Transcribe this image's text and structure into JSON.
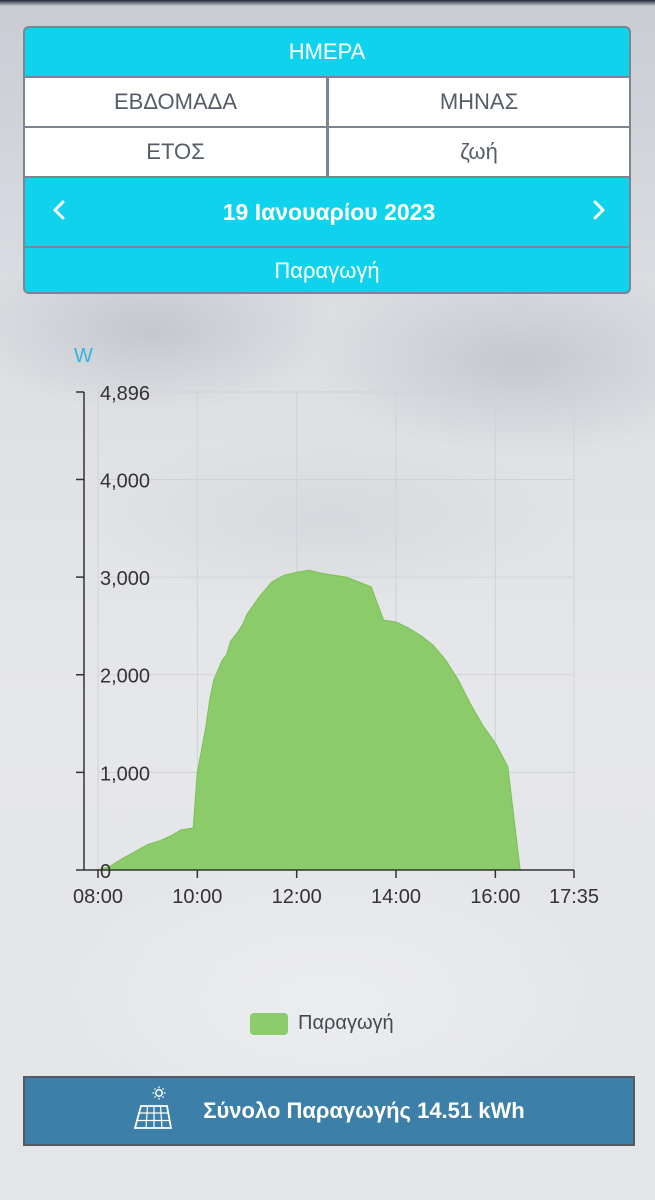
{
  "nav": {
    "day": "ΗΜΕΡΑ",
    "week": "ΕΒΔΟΜΑΔΑ",
    "month": "ΜΗΝΑΣ",
    "year": "ΕΤΟΣ",
    "life": "ζωή",
    "date": "19 Ιανουαρίου 2023",
    "prev_icon": "chevron-left-icon",
    "next_icon": "chevron-right-icon",
    "metric": "Παραγωγή"
  },
  "colors": {
    "accent": "#0fd3ec",
    "area_fill": "#8ccb6a",
    "total_bar": "#3c7fa8"
  },
  "chart_data": {
    "type": "area",
    "unit": "W",
    "y_ticks": [
      "4,896",
      "4,000",
      "3,000",
      "2,000",
      "1,000",
      "0"
    ],
    "y_tick_values": [
      4896,
      4000,
      3000,
      2000,
      1000,
      0
    ],
    "x_ticks": [
      "08:00",
      "10:00",
      "12:00",
      "14:00",
      "16:00",
      "17:35"
    ],
    "x_tick_values": [
      "08:00",
      "10:00",
      "12:00",
      "14:00",
      "16:00",
      "17:35"
    ],
    "ylim": [
      0,
      4896
    ],
    "xlim": [
      "08:00",
      "17:35"
    ],
    "grid": true,
    "legend_position": "bottom",
    "series": [
      {
        "name": "Παραγωγή",
        "x": [
          "08:00",
          "08:15",
          "08:30",
          "08:45",
          "09:00",
          "09:15",
          "09:30",
          "09:40",
          "09:55",
          "10:00",
          "10:10",
          "10:15",
          "10:20",
          "10:30",
          "10:35",
          "10:40",
          "10:50",
          "10:55",
          "11:00",
          "11:15",
          "11:30",
          "11:45",
          "12:00",
          "12:15",
          "12:30",
          "12:45",
          "13:00",
          "13:15",
          "13:30",
          "13:45",
          "14:00",
          "14:15",
          "14:30",
          "14:45",
          "15:00",
          "15:15",
          "15:30",
          "15:45",
          "16:00",
          "16:15",
          "16:30",
          "16:45",
          "17:00",
          "17:15",
          "17:35"
        ],
        "y": [
          0,
          40,
          120,
          190,
          260,
          300,
          360,
          410,
          430,
          1000,
          1450,
          1750,
          1950,
          2150,
          2200,
          2340,
          2450,
          2520,
          2620,
          2800,
          2950,
          3020,
          3050,
          3070,
          3040,
          3020,
          3000,
          2950,
          2900,
          2560,
          2540,
          2480,
          2400,
          2300,
          2150,
          1950,
          1700,
          1480,
          1300,
          1060,
          0,
          0,
          0,
          0,
          0
        ]
      }
    ]
  },
  "legend": {
    "label": "Παραγωγή"
  },
  "total": {
    "label": "Σύνολο Παραγωγής 14.51 kWh",
    "icon": "solar-panel-icon"
  }
}
